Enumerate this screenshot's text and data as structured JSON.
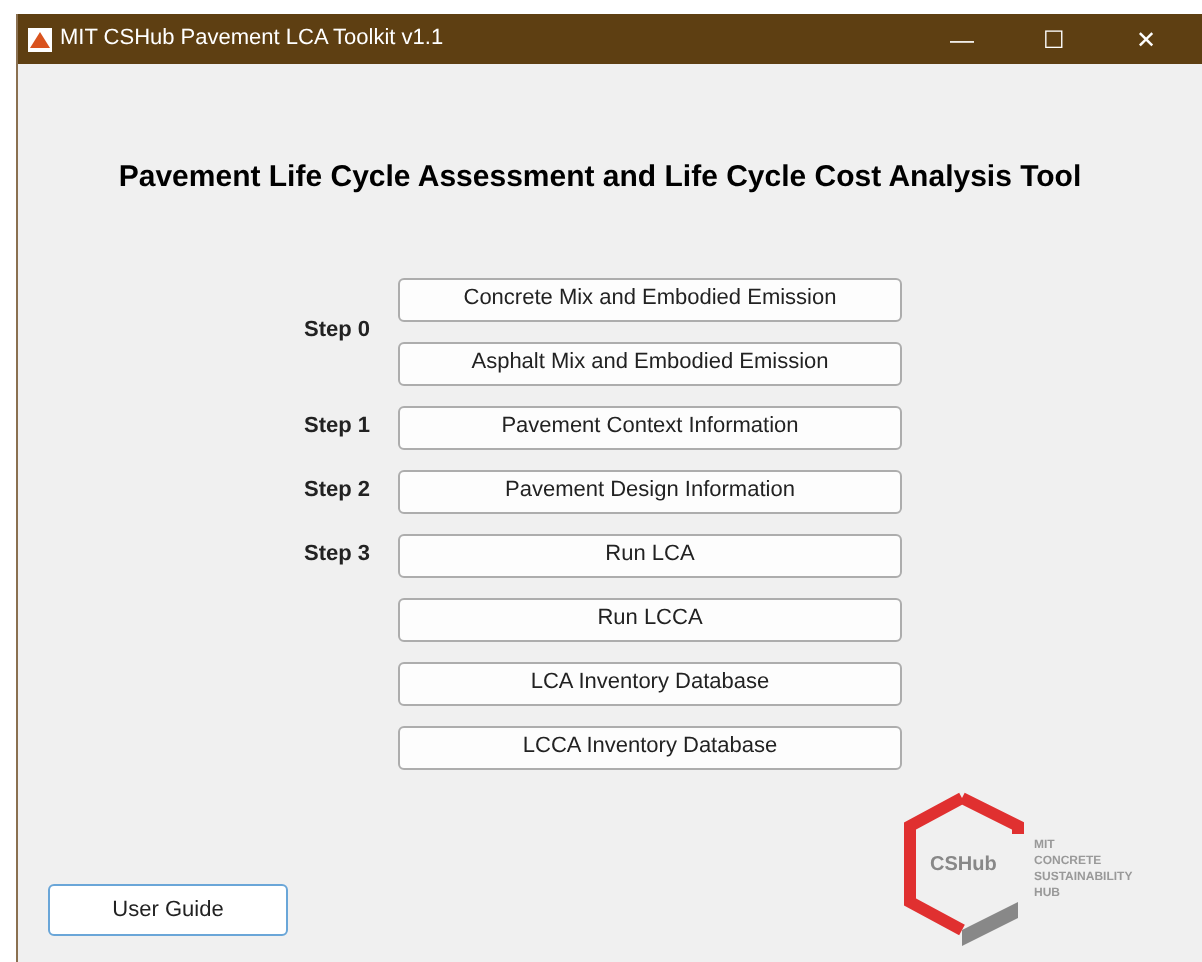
{
  "window": {
    "title": "MIT CSHub Pavement LCA Toolkit v1.1",
    "controls": [
      "—",
      "☐",
      "✕"
    ]
  },
  "heading": "Pavement Life Cycle Assessment and Life Cycle Cost Analysis Tool",
  "groups": [
    {
      "step": "Step 0",
      "buttons": [
        "Concrete Mix and Embodied Emission",
        "Asphalt Mix and Embodied Emission"
      ]
    },
    {
      "step": "Step 1",
      "buttons": [
        "Pavement Context Information"
      ]
    },
    {
      "step": "Step 2",
      "buttons": [
        "Pavement Design Information"
      ]
    },
    {
      "step": "Step 3",
      "buttons": [
        "Run LCA"
      ]
    },
    {
      "buttons": [
        "Run LCCA",
        "LCA Inventory Database",
        "LCCA Inventory Database"
      ]
    }
  ],
  "user_guide": "User Guide",
  "logo": {
    "mark": "CSHub",
    "lines": [
      "MIT",
      "CONCRETE",
      "SUSTAINABILITY",
      "HUB"
    ]
  }
}
